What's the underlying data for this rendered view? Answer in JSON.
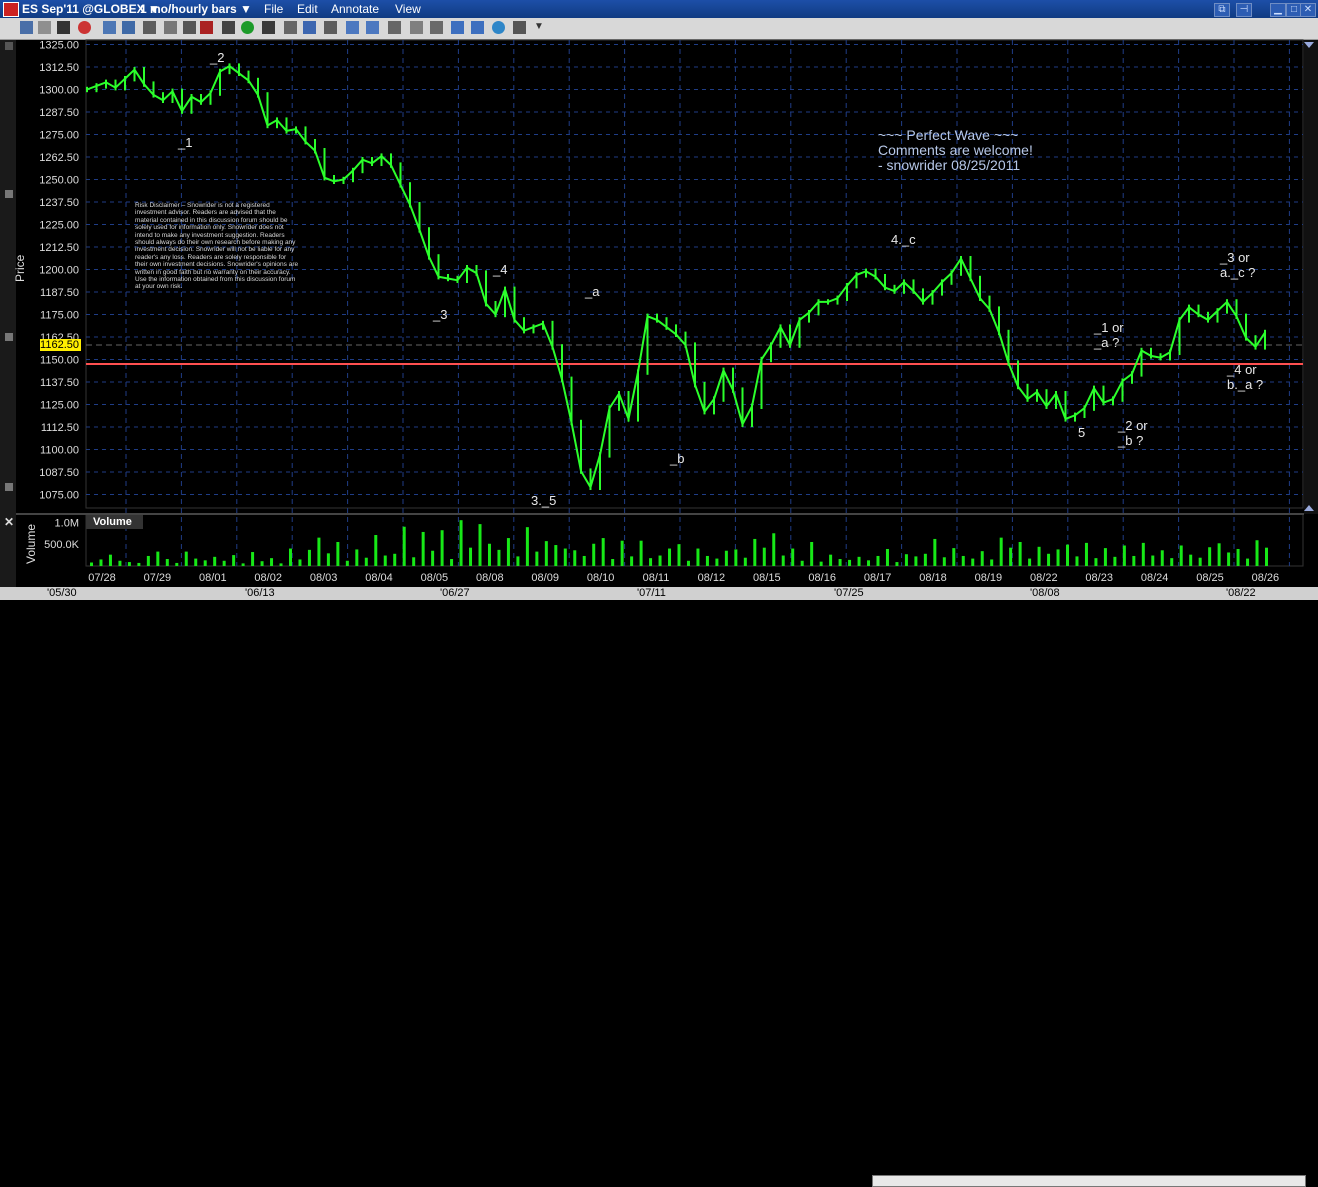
{
  "window": {
    "symbol": "ES Sep'11 @GLOBEX",
    "period": "1 mo/hourly bars",
    "menu": [
      "File",
      "Edit",
      "Annotate",
      "View"
    ]
  },
  "colors": {
    "price_line": "#2bff2b",
    "volume_bar": "#17e817",
    "reference_line": "#ff5050",
    "current_price_box": "#ffee00",
    "grid": "#1f3d86",
    "background": "#000000"
  },
  "price_panel": {
    "axis_label": "Price",
    "current_price": "1162.50",
    "reference_level": 1147.5
  },
  "volume_panel": {
    "title": "Volume",
    "axis_label": "Volume",
    "ticks": [
      "1.0M",
      "500.0K"
    ]
  },
  "annotations": {
    "wave_title": [
      "~~~ Perfect Wave ~~~",
      "Comments are welcome!",
      "- snowrider  08/25/2011"
    ],
    "disclaimer": "Risk Disclaimer – Snowrider is not a registered investment advisor. Readers are advised that the material contained in this discussion forum should be solely used for information only. Snowrider does not intend to make any investment suggestion. Readers should always do their own research before making any investment decision. Snowrider will not be liable for any reader's any loss. Readers are solely responsible for their own investment decisions. Snowrider's opinions are written in good faith but no warranty on their accuracy. Use the information obtained from this discussion forum at your own risk.",
    "labels": [
      {
        "id": "w1",
        "text": "_1"
      },
      {
        "id": "w2",
        "text": "_2"
      },
      {
        "id": "w3",
        "text": "_3"
      },
      {
        "id": "w4",
        "text": "_4"
      },
      {
        "id": "w35",
        "text": "3._5"
      },
      {
        "id": "wa",
        "text": "_a"
      },
      {
        "id": "wb",
        "text": "_b"
      },
      {
        "id": "w4c",
        "text": "4._c"
      },
      {
        "id": "w5",
        "text": "5"
      },
      {
        "id": "w1a",
        "text": "_1 or\n_a ?"
      },
      {
        "id": "w2b",
        "text": "_2 or\n_b ?"
      },
      {
        "id": "w3ac",
        "text": "_3 or\na._c ?"
      },
      {
        "id": "w4ba",
        "text": "_4 or\nb._a ?"
      }
    ]
  },
  "bottom_navigator": {
    "labels": [
      "'05/30",
      "'06/13",
      "'06/27",
      "'07/11",
      "'07/25",
      "'08/08",
      "'08/22"
    ]
  },
  "chart_data": [
    {
      "type": "line",
      "title": "",
      "xlabel": "",
      "ylabel": "Price",
      "ylim": [
        1067.5,
        1327.5
      ],
      "yticks": [
        1325.0,
        1312.5,
        1300.0,
        1287.5,
        1275.0,
        1262.5,
        1250.0,
        1237.5,
        1225.0,
        1212.5,
        1200.0,
        1187.5,
        1175.0,
        1162.5,
        1150.0,
        1137.5,
        1125.0,
        1112.5,
        1100.0,
        1087.5,
        1075.0
      ],
      "categories": [
        "07/28",
        "07/29",
        "08/01",
        "08/02",
        "08/03",
        "08/04",
        "08/05",
        "08/08",
        "08/09",
        "08/10",
        "08/11",
        "08/12",
        "08/15",
        "08/16",
        "08/17",
        "08/18",
        "08/19",
        "08/22",
        "08/23",
        "08/24",
        "08/25",
        "08/26"
      ],
      "grid": true,
      "series": [
        {
          "values": [
            1300,
            1302,
            1304,
            1301,
            1306,
            1311,
            1303,
            1297,
            1294,
            1299,
            1288,
            1296,
            1293,
            1298,
            1310,
            1313,
            1309,
            1305,
            1297,
            1280,
            1283,
            1277,
            1278,
            1271,
            1266,
            1251,
            1249,
            1250,
            1255,
            1261,
            1259,
            1263,
            1258,
            1247,
            1236,
            1222,
            1207,
            1196,
            1195,
            1194,
            1201,
            1198,
            1181,
            1175,
            1189,
            1172,
            1166,
            1168,
            1170,
            1157,
            1139,
            1115,
            1088,
            1079,
            1097,
            1123,
            1131,
            1117,
            1143,
            1174,
            1172,
            1168,
            1164,
            1158,
            1136,
            1121,
            1128,
            1144,
            1133,
            1114,
            1124,
            1150,
            1158,
            1168,
            1158,
            1172,
            1176,
            1182,
            1182,
            1184,
            1191,
            1197,
            1199,
            1196,
            1190,
            1188,
            1193,
            1188,
            1182,
            1187,
            1193,
            1198,
            1206,
            1195,
            1184,
            1178,
            1165,
            1148,
            1135,
            1128,
            1132,
            1124,
            1131,
            1117,
            1119,
            1123,
            1134,
            1126,
            1128,
            1138,
            1142,
            1155,
            1152,
            1151,
            1154,
            1172,
            1179,
            1175,
            1172,
            1177,
            1182,
            1174,
            1162,
            1157,
            1165
          ]
        }
      ]
    },
    {
      "type": "bar",
      "title": "Volume",
      "xlabel": "",
      "ylabel": "Volume",
      "ylim": [
        0,
        1100000
      ],
      "series": [
        {
          "name": "Volume",
          "values": [
            80000,
            150000,
            260000,
            120000,
            90000,
            70000,
            230000,
            330000,
            160000,
            70000,
            330000,
            170000,
            130000,
            210000,
            120000,
            250000,
            60000,
            320000,
            110000,
            180000,
            60000,
            400000,
            150000,
            370000,
            650000,
            290000,
            550000,
            120000,
            380000,
            190000,
            710000,
            240000,
            280000,
            900000,
            200000,
            780000,
            350000,
            820000,
            160000,
            1050000,
            420000,
            960000,
            510000,
            370000,
            640000,
            220000,
            890000,
            330000,
            570000,
            480000,
            400000,
            360000,
            230000,
            510000,
            640000,
            160000,
            580000,
            220000,
            580000,
            180000,
            240000,
            400000,
            500000,
            120000,
            400000,
            230000,
            170000,
            350000,
            380000,
            190000,
            620000,
            420000,
            750000,
            240000,
            400000,
            120000,
            550000,
            100000,
            260000,
            160000,
            140000,
            210000,
            130000,
            230000,
            390000,
            90000,
            270000,
            220000,
            280000,
            620000,
            200000,
            410000,
            230000,
            170000,
            340000,
            150000,
            650000,
            420000,
            550000,
            170000,
            440000,
            280000,
            380000,
            490000,
            220000,
            530000,
            180000,
            410000,
            210000,
            470000,
            230000,
            530000,
            240000,
            360000,
            180000,
            470000,
            260000,
            190000,
            430000,
            520000,
            310000,
            390000,
            170000,
            590000,
            420000
          ]
        }
      ]
    }
  ]
}
